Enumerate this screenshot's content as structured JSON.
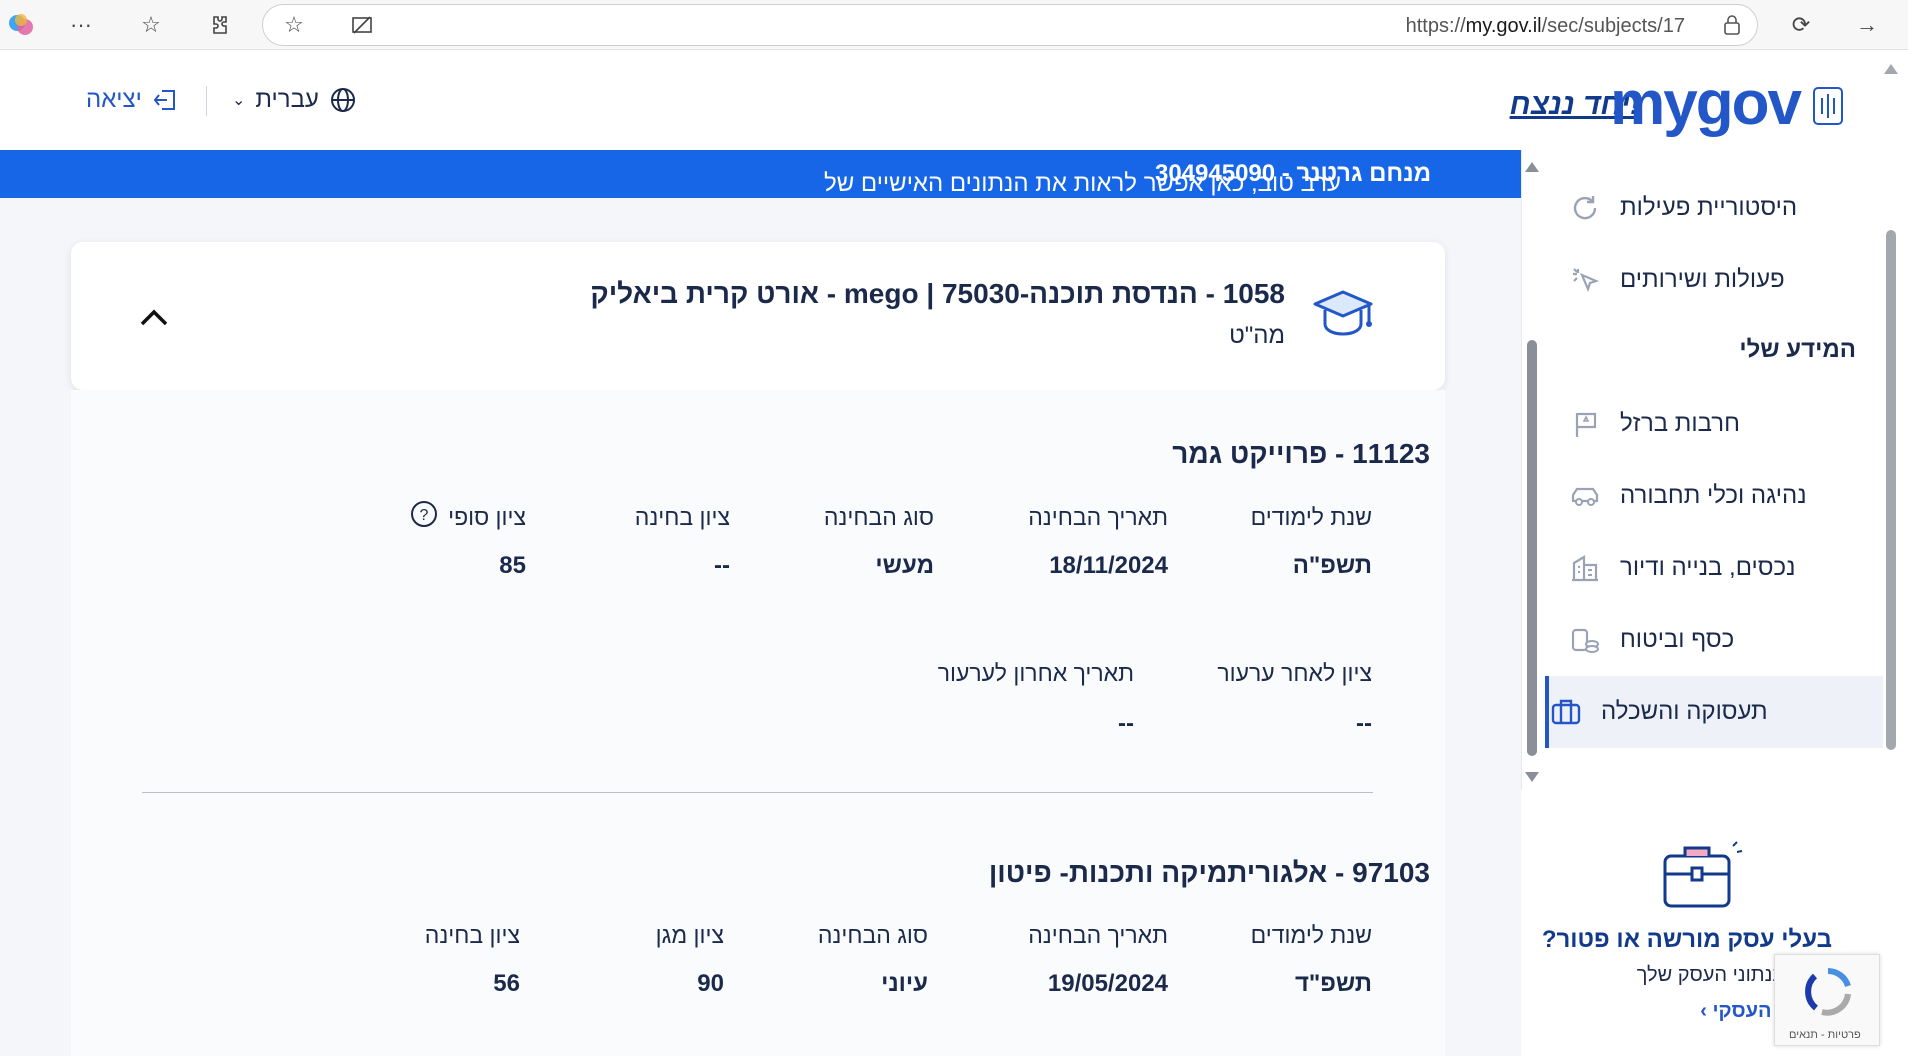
{
  "browser": {
    "url_prefix": "https://",
    "url_host": "my.gov.il",
    "url_path": "/sec/subjects/17"
  },
  "header": {
    "logo_text": "mygov",
    "slogan": "יחד ננצח!",
    "language_label": "עברית",
    "logout_label": "יציאה"
  },
  "greeting": {
    "prefix": "ערב טוב,  כאן אפשר לראות את הנתונים האישיים של ",
    "name_and_id": "מנחם גרטנר - 304945090"
  },
  "institution": {
    "title": "1058 - הנדסת תוכנה-mego  |  75030 - אורט קרית ביאליק",
    "subtitle": "מה\"ט"
  },
  "subjects": [
    {
      "title": "11123 - פרוייקט גמר",
      "labels": [
        "שנת לימודים",
        "תאריך הבחינה",
        "סוג הבחינה",
        "ציון בחינה",
        "ציון סופי"
      ],
      "values": [
        "תשפ\"ה",
        "18/11/2024",
        "מעשי",
        "--",
        "85"
      ],
      "appeal_labels": [
        "ציון לאחר ערעור",
        "תאריך אחרון לערעור"
      ],
      "appeal_values": [
        "--",
        "--"
      ]
    },
    {
      "title": "97103 - אלגוריתמיקה ותכנות- פיטון",
      "labels": [
        "שנת לימודים",
        "תאריך הבחינה",
        "סוג הבחינה",
        "ציון מגן",
        "ציון בחינה"
      ],
      "values": [
        "תשפ\"ד",
        "19/05/2024",
        "עיוני",
        "90",
        "56"
      ]
    }
  ],
  "sidebar": {
    "items": [
      {
        "label": "היסטוריית פעילות",
        "icon": "history-icon"
      },
      {
        "label": "פעולות ושירותים",
        "icon": "actions-icon"
      }
    ],
    "heading": "המידע שלי",
    "info_items": [
      {
        "label": "חרבות ברזל",
        "icon": "flag-icon"
      },
      {
        "label": "נהיגה וכלי תחבורה",
        "icon": "car-icon"
      },
      {
        "label": "נכסים, בנייה ודיור",
        "icon": "building-icon"
      },
      {
        "label": "כסף וביטוח",
        "icon": "coins-icon"
      },
      {
        "label": "תעסוקה והשכלה",
        "icon": "briefcase-icon",
        "active": true
      }
    ]
  },
  "promo": {
    "title": "בעלי עסק מורשה או פטור?",
    "text": "צפות בנתוני העסק שלך",
    "link": "חשבון העסקי ›"
  },
  "recaptcha": {
    "text": "פרטיות - תנאים"
  },
  "colors": {
    "accent": "#2356c7",
    "banner": "#1766e8",
    "text": "#1b2a4a"
  }
}
